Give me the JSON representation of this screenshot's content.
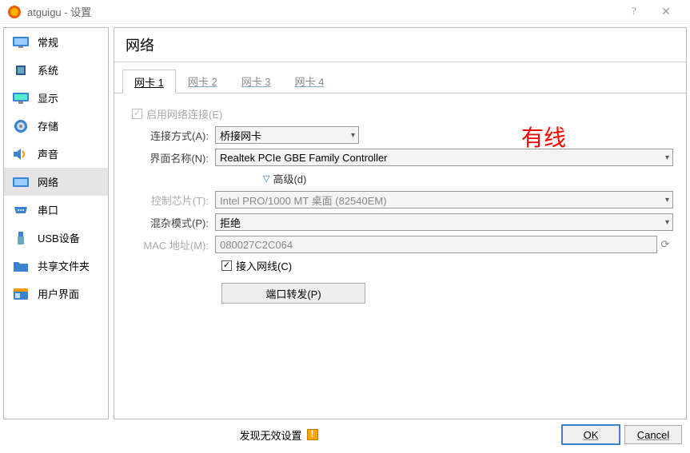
{
  "titlebar": {
    "title": "atguigu - 设置"
  },
  "sidebar": {
    "items": [
      {
        "label": "常规"
      },
      {
        "label": "系统"
      },
      {
        "label": "显示"
      },
      {
        "label": "存储"
      },
      {
        "label": "声音"
      },
      {
        "label": "网络"
      },
      {
        "label": "串口"
      },
      {
        "label": "USB设备"
      },
      {
        "label": "共享文件夹"
      },
      {
        "label": "用户界面"
      }
    ]
  },
  "panel": {
    "title": "网络"
  },
  "tabs": {
    "items": [
      "网卡 1",
      "网卡 2",
      "网卡 3",
      "网卡 4"
    ]
  },
  "form": {
    "enable_label": "启用网络连接(E)",
    "attach_label": "连接方式(A):",
    "attach_value": "桥接网卡",
    "name_label": "界面名称(N):",
    "name_value": "Realtek PCIe GBE Family Controller",
    "advanced_label": "高级(d)",
    "chipset_label": "控制芯片(T):",
    "chipset_value": "Intel PRO/1000 MT 桌面 (82540EM)",
    "promisc_label": "混杂模式(P):",
    "promisc_value": "拒绝",
    "mac_label": "MAC 地址(M):",
    "mac_value": "080027C2C064",
    "cable_label": "接入网线(C)",
    "portfwd_label": "端口转发(P)",
    "annotation": "有线"
  },
  "footer": {
    "status": "发现无效设置",
    "ok": "OK",
    "cancel": "Cancel"
  }
}
